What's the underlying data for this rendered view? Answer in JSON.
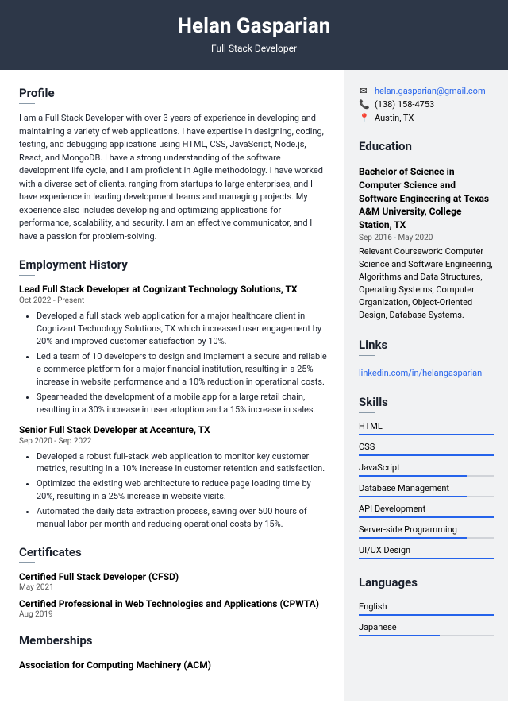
{
  "header": {
    "name": "Helan Gasparian",
    "role": "Full Stack Developer"
  },
  "profile": {
    "heading": "Profile",
    "text": "I am a Full Stack Developer with over 3 years of experience in developing and maintaining a variety of web applications. I have expertise in designing, coding, testing, and debugging applications using HTML, CSS, JavaScript, Node.js, React, and MongoDB. I have a strong understanding of the software development life cycle, and I am proficient in Agile methodology. I have worked with a diverse set of clients, ranging from startups to large enterprises, and I have experience in leading development teams and managing projects. My experience also includes developing and optimizing applications for performance, scalability, and security. I am an effective communicator, and I have a passion for problem-solving."
  },
  "employment": {
    "heading": "Employment History",
    "jobs": [
      {
        "title": "Lead Full Stack Developer at Cognizant Technology Solutions, TX",
        "dates": "Oct 2022 - Present",
        "bullets": [
          "Developed a full stack web application for a major healthcare client in Cognizant Technology Solutions, TX which increased user engagement by 20% and improved customer satisfaction by 10%.",
          "Led a team of 10 developers to design and implement a secure and reliable e-commerce platform for a major financial institution, resulting in a 25% increase in website performance and a 10% reduction in operational costs.",
          "Spearheaded the development of a mobile app for a large retail chain, resulting in a 30% increase in user adoption and a 15% increase in sales."
        ]
      },
      {
        "title": "Senior Full Stack Developer at Accenture, TX",
        "dates": "Sep 2020 - Sep 2022",
        "bullets": [
          "Developed a robust full-stack web application to monitor key customer metrics, resulting in a 10% increase in customer retention and satisfaction.",
          "Optimized the existing web architecture to reduce page loading time by 20%, resulting in a 25% increase in website visits.",
          "Automated the daily data extraction process, saving over 500 hours of manual labor per month and reducing operational costs by 15%."
        ]
      }
    ]
  },
  "certificates": {
    "heading": "Certificates",
    "items": [
      {
        "title": "Certified Full Stack Developer (CFSD)",
        "date": "May 2021"
      },
      {
        "title": "Certified Professional in Web Technologies and Applications (CPWTA)",
        "date": "Aug 2019"
      }
    ]
  },
  "memberships": {
    "heading": "Memberships",
    "items": [
      {
        "title": "Association for Computing Machinery (ACM)"
      }
    ]
  },
  "contact": {
    "email": "helan.gasparian@gmail.com",
    "phone": "(138) 158-4753",
    "location": "Austin, TX"
  },
  "education": {
    "heading": "Education",
    "degree": "Bachelor of Science in Computer Science and Software Engineering at Texas A&M University, College Station, TX",
    "dates": "Sep 2016 - May 2020",
    "text": "Relevant Coursework: Computer Science and Software Engineering, Algorithms and Data Structures, Operating Systems, Computer Organization, Object-Oriented Design, Database Systems."
  },
  "links": {
    "heading": "Links",
    "url": "linkedin.com/in/helangasparian"
  },
  "skills": {
    "heading": "Skills",
    "items": [
      {
        "name": "HTML",
        "level": 100
      },
      {
        "name": "CSS",
        "level": 100
      },
      {
        "name": "JavaScript",
        "level": 80
      },
      {
        "name": "Database Management",
        "level": 80
      },
      {
        "name": "API Development",
        "level": 100
      },
      {
        "name": "Server-side Programming",
        "level": 80
      },
      {
        "name": "UI/UX Design",
        "level": 100
      }
    ]
  },
  "languages": {
    "heading": "Languages",
    "items": [
      {
        "name": "English",
        "level": 100
      },
      {
        "name": "Japanese",
        "level": 60
      }
    ]
  }
}
